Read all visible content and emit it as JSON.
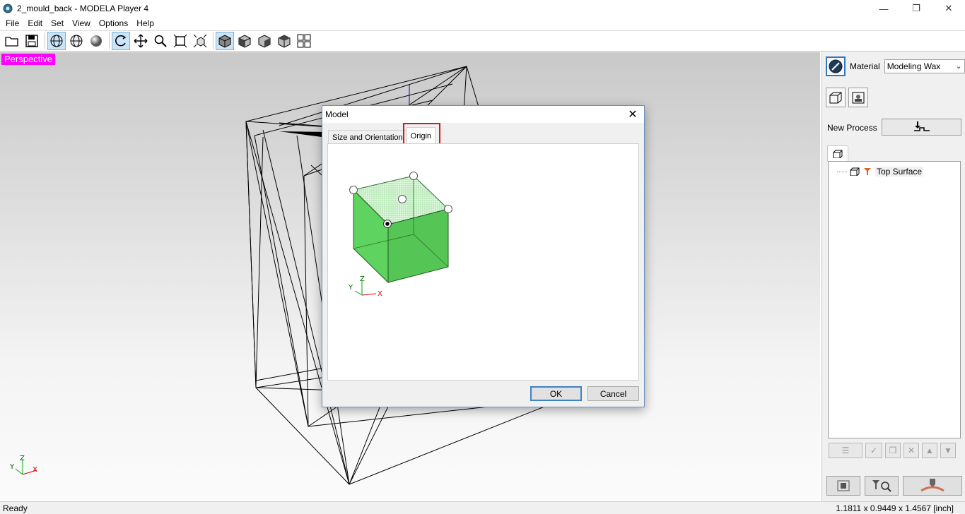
{
  "window": {
    "title": "2_mould_back - MODELA Player 4"
  },
  "menu": [
    "File",
    "Edit",
    "Set",
    "View",
    "Options",
    "Help"
  ],
  "viewport": {
    "label": "Perspective",
    "axis": {
      "x": "X",
      "y": "Y",
      "z": "Z"
    }
  },
  "dialog": {
    "title": "Model",
    "tabs": [
      "Size and Orientation",
      "Origin"
    ],
    "selected_tab": "Origin",
    "axis": {
      "x": "X",
      "y": "Y",
      "z": "Z"
    },
    "ok_label": "OK",
    "cancel_label": "Cancel"
  },
  "right_panel": {
    "material_label": "Material",
    "material_value": "Modeling Wax",
    "new_process_label": "New Process",
    "tree_items": [
      "Top Surface"
    ]
  },
  "status": {
    "left": "Ready",
    "right": "1.1811 x 0.9449 x 1.4567 [inch]"
  },
  "colors": {
    "perspective_label_bg": "#ff00ff",
    "tab_highlight": "#e0101c",
    "cube_face": "#5fd35f",
    "default_button_border": "#3d83c8"
  }
}
